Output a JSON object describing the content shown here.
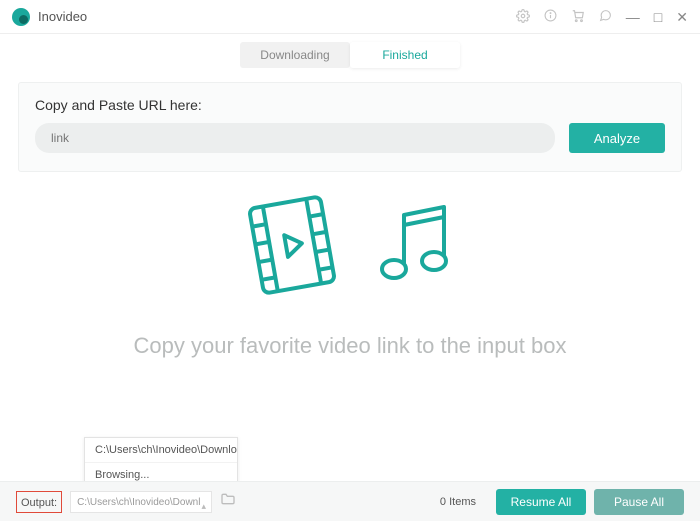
{
  "app": {
    "title": "Inovideo"
  },
  "tabs": {
    "downloading": "Downloading",
    "finished": "Finished",
    "active": "Finished"
  },
  "url_panel": {
    "label": "Copy and Paste URL here:",
    "placeholder": "link",
    "analyze": "Analyze"
  },
  "hint": "Copy your favorite video link to the input box",
  "output_menu": {
    "item1": "C:\\Users\\ch\\Inovideo\\Downloads",
    "item2": "Browsing..."
  },
  "footer": {
    "output_label": "Output:",
    "path": "C:\\Users\\ch\\Inovideo\\Downl",
    "items": "0 Items",
    "resume": "Resume All",
    "pause": "Pause All"
  }
}
